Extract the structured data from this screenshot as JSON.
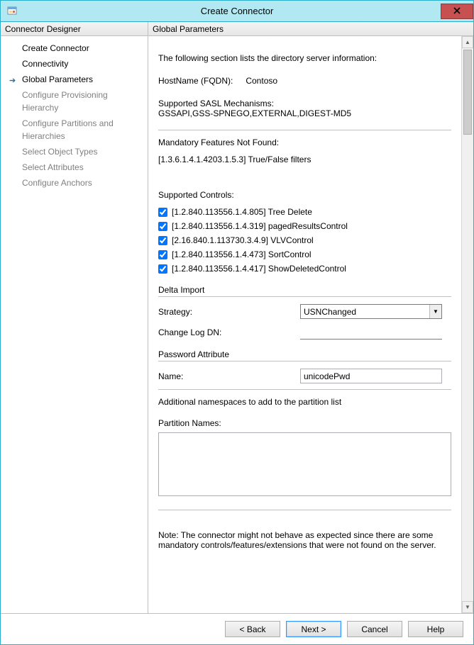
{
  "window": {
    "title": "Create Connector"
  },
  "panels": {
    "left_header": "Connector Designer",
    "right_header": "Global Parameters"
  },
  "sidebar": {
    "items": [
      {
        "label": "Create Connector",
        "state": "enabled"
      },
      {
        "label": "Connectivity",
        "state": "enabled"
      },
      {
        "label": "Global Parameters",
        "state": "current"
      },
      {
        "label": "Configure Provisioning Hierarchy",
        "state": "disabled"
      },
      {
        "label": "Configure Partitions and Hierarchies",
        "state": "disabled"
      },
      {
        "label": "Select Object Types",
        "state": "disabled"
      },
      {
        "label": "Select Attributes",
        "state": "disabled"
      },
      {
        "label": "Configure Anchors",
        "state": "disabled"
      }
    ]
  },
  "content": {
    "intro": "The following section lists the directory server information:",
    "hostname_label": "HostName (FQDN):",
    "hostname_value": "Contoso",
    "sasl_label": "Supported SASL Mechanisms:",
    "sasl_value": "GSSAPI,GSS-SPNEGO,EXTERNAL,DIGEST-MD5",
    "mandatory_header": "Mandatory Features Not Found:",
    "mandatory_value": "[1.3.6.1.4.1.4203.1.5.3] True/False filters",
    "controls_header": "Supported Controls:",
    "controls": [
      {
        "label": "[1.2.840.113556.1.4.805] Tree Delete",
        "checked": true
      },
      {
        "label": "[1.2.840.113556.1.4.319] pagedResultsControl",
        "checked": true
      },
      {
        "label": "[2.16.840.1.113730.3.4.9] VLVControl",
        "checked": true
      },
      {
        "label": "[1.2.840.113556.1.4.473] SortControl",
        "checked": true
      },
      {
        "label": "[1.2.840.113556.1.4.417] ShowDeletedControl",
        "checked": true
      }
    ],
    "delta_header": "Delta Import",
    "strategy_label": "Strategy:",
    "strategy_value": "USNChanged",
    "changelog_label": "Change Log DN:",
    "changelog_value": "",
    "pwd_header": "Password Attribute",
    "pwd_name_label": "Name:",
    "pwd_name_value": "unicodePwd",
    "ns_intro": "Additional namespaces to add to the partition list",
    "partition_label": "Partition Names:",
    "partition_value": "",
    "note": "Note: The connector might not behave as expected since there are some mandatory controls/features/extensions that were not found on the server."
  },
  "buttons": {
    "back": "<  Back",
    "next": "Next  >",
    "cancel": "Cancel",
    "help": "Help"
  }
}
